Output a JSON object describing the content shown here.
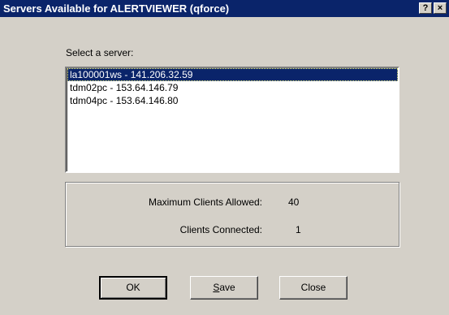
{
  "window": {
    "title": "Servers Available for ALERTVIEWER (qforce)",
    "help_glyph": "?",
    "close_glyph": "×"
  },
  "prompt": "Select a server:",
  "servers": [
    {
      "label": "la100001ws - 141.206.32.59",
      "selected": true
    },
    {
      "label": "tdm02pc - 153.64.146.79",
      "selected": false
    },
    {
      "label": "tdm04pc - 153.64.146.80",
      "selected": false
    }
  ],
  "info": {
    "max_clients_label": "Maximum Clients Allowed:",
    "max_clients_value": "40",
    "clients_connected_label": "Clients Connected:",
    "clients_connected_value": "1"
  },
  "buttons": {
    "ok": "OK",
    "save_accel": "S",
    "save_rest": "ave",
    "close": "Close"
  },
  "colors": {
    "titlebar": "#0a246a",
    "face": "#d4d0c8",
    "selection": "#0a246a"
  }
}
